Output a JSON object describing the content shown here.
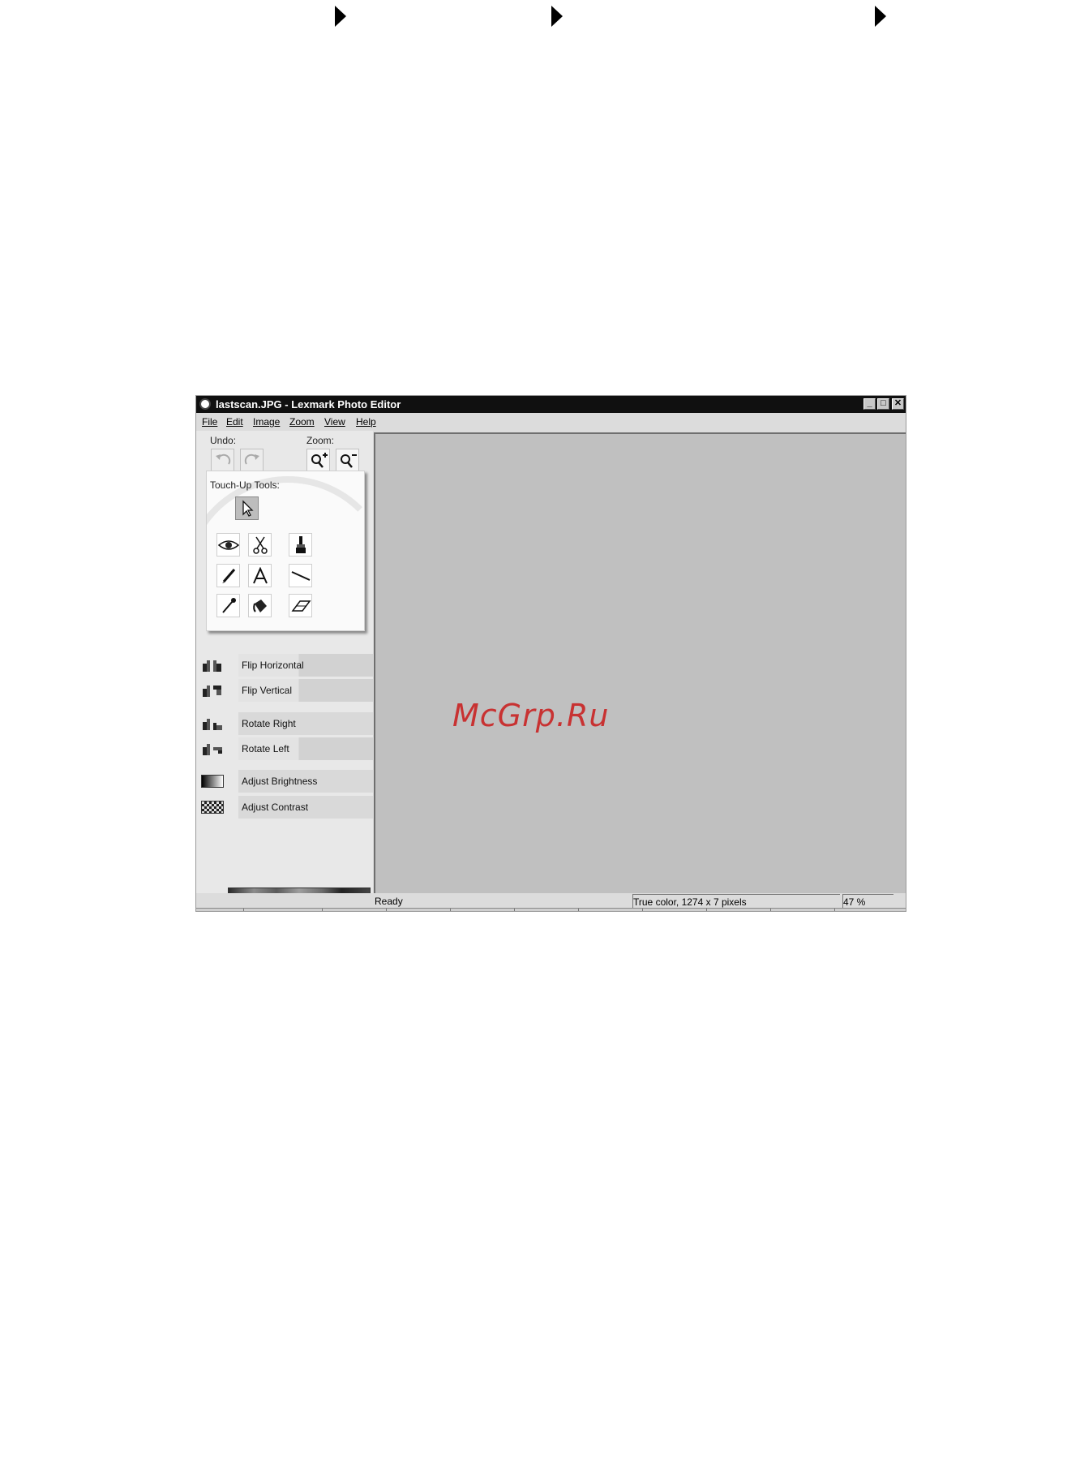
{
  "window": {
    "title": "lastscan.JPG - Lexmark Photo Editor",
    "minimize": "_",
    "maximize": "□",
    "close": "✕"
  },
  "menu": [
    "File",
    "Edit",
    "Image",
    "Zoom",
    "View",
    "Help"
  ],
  "undo": {
    "label": "Undo:",
    "icons": [
      "undo-icon",
      "redo-icon"
    ]
  },
  "zoom": {
    "label": "Zoom:",
    "icons": [
      "zoom-in-icon",
      "zoom-out-icon"
    ]
  },
  "touchup": {
    "label": "Touch-Up Tools:",
    "tools": [
      "pointer-icon",
      "red-eye-icon",
      "scissors-icon",
      "brush-icon",
      "pencil-icon",
      "text-icon",
      "line-icon",
      "dropper-icon",
      "fill-icon",
      "eraser-icon"
    ]
  },
  "actions": [
    {
      "label": "Flip Horizontal",
      "icon": "flip-horizontal-icon"
    },
    {
      "label": "Flip Vertical",
      "icon": "flip-vertical-icon"
    },
    {
      "label": "Rotate Right",
      "icon": "rotate-right-icon"
    },
    {
      "label": "Rotate Left",
      "icon": "rotate-left-icon"
    },
    {
      "label": "Adjust Brightness",
      "icon": "brightness-icon"
    },
    {
      "label": "Adjust Contrast",
      "icon": "contrast-icon"
    }
  ],
  "watermark": "McGrp.Ru",
  "status": {
    "ready": "Ready",
    "info": "True color, 1274 x 7 pixels",
    "zoom": "47 %"
  },
  "colors": {
    "titlebar": "#101010",
    "canvas": "#c0c0c0",
    "panel": "#e8e8e8",
    "watermark": "#c83232"
  }
}
